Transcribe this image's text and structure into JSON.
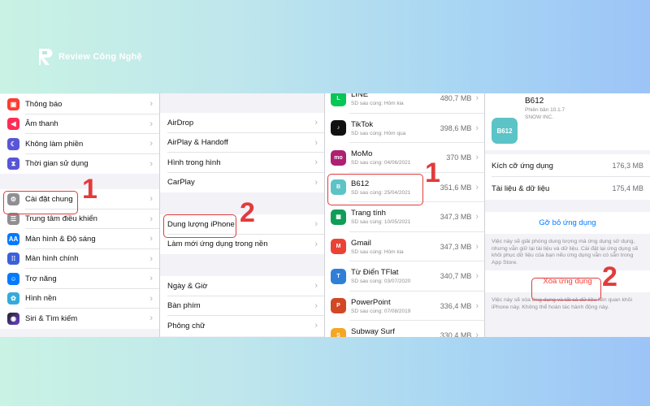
{
  "brand": {
    "name": "Review Công Nghệ"
  },
  "settings_panel": {
    "groups": [
      [
        {
          "label": "Thông báo",
          "icon": "notification-icon",
          "color": "#ff3b30"
        },
        {
          "label": "Âm thanh",
          "icon": "sound-icon",
          "color": "#ff2d55"
        },
        {
          "label": "Không làm phiền",
          "icon": "moon-icon",
          "color": "#5856d6"
        },
        {
          "label": "Thời gian sử dụng",
          "icon": "hourglass-icon",
          "color": "#5856d6"
        }
      ],
      [
        {
          "label": "Cài đặt chung",
          "icon": "gear-icon",
          "color": "#8e8e93"
        },
        {
          "label": "Trung tâm điều khiển",
          "icon": "control-center-icon",
          "color": "#8e8e93"
        },
        {
          "label": "Màn hình & Độ sáng",
          "icon": "display-icon",
          "color": "#007aff"
        },
        {
          "label": "Màn hình chính",
          "icon": "home-screen-icon",
          "color": "#3c5fdc"
        },
        {
          "label": "Trợ năng",
          "icon": "accessibility-icon",
          "color": "#007aff"
        },
        {
          "label": "Hình nền",
          "icon": "wallpaper-icon",
          "color": "#34aadc"
        },
        {
          "label": "Siri & Tìm kiếm",
          "icon": "siri-icon",
          "color": "#222222"
        }
      ]
    ],
    "step": "1"
  },
  "general_panel": {
    "groups": [
      [
        "AirDrop",
        "AirPlay & Handoff",
        "Hình trong hình",
        "CarPlay"
      ],
      [
        "Dung lượng iPhone",
        "Làm mới ứng dụng trong nền"
      ],
      [
        "Ngày & Giờ",
        "Bàn phím",
        "Phông chữ"
      ]
    ],
    "step": "2"
  },
  "storage_panel": {
    "apps": [
      {
        "name": "LINE",
        "meta": "SD sau cùng: Hôm kia",
        "size": "480,7 MB",
        "color": "#06c755",
        "icon": "line-app-icon",
        "glyph": "L"
      },
      {
        "name": "TikTok",
        "meta": "SD sau cùng: Hôm qua",
        "size": "398,6 MB",
        "color": "#111111",
        "icon": "tiktok-app-icon",
        "glyph": "♪"
      },
      {
        "name": "MoMo",
        "meta": "SD sau cùng: 04/06/2021",
        "size": "370 MB",
        "color": "#ae2070",
        "icon": "momo-app-icon",
        "glyph": "mo"
      },
      {
        "name": "B612",
        "meta": "SD sau cùng: 25/04/2021",
        "size": "351,6 MB",
        "color": "#5cc3c7",
        "icon": "b612-app-icon",
        "glyph": "B"
      },
      {
        "name": "Trang tính",
        "meta": "SD sau cùng: 10/05/2021",
        "size": "347,3 MB",
        "color": "#0f9d58",
        "icon": "sheets-app-icon",
        "glyph": "▦"
      },
      {
        "name": "Gmail",
        "meta": "SD sau cùng: Hôm kia",
        "size": "347,3 MB",
        "color": "#ea4335",
        "icon": "gmail-app-icon",
        "glyph": "M"
      },
      {
        "name": "Từ Điển TFlat",
        "meta": "SD sau cùng: 03/07/2020",
        "size": "340,7 MB",
        "color": "#2f7fd8",
        "icon": "tflat-app-icon",
        "glyph": "T"
      },
      {
        "name": "PowerPoint",
        "meta": "SD sau cùng: 07/08/2019",
        "size": "336,4 MB",
        "color": "#d24726",
        "icon": "powerpoint-app-icon",
        "glyph": "P"
      },
      {
        "name": "Subway Surf",
        "meta": "SD sau cùng: 17/05/2021",
        "size": "330,4 MB",
        "color": "#f5a623",
        "icon": "subway-app-icon",
        "glyph": "S"
      }
    ],
    "step": "1"
  },
  "detail_panel": {
    "app_name": "B612",
    "version": "Phiên bản 10.1.7",
    "developer": "SNOW INC.",
    "icon_text": "B612",
    "app_size_label": "Kích cỡ ứng dụng",
    "app_size_value": "176,3 MB",
    "data_label": "Tài liệu & dữ liệu",
    "data_value": "175,4 MB",
    "offload_label": "Gỡ bỏ ứng dụng",
    "offload_note": "Việc này sẽ giải phóng dung lượng mà ứng dụng sử dụng, nhưng vẫn giữ lại tài liệu và dữ liệu. Cài đặt lại ứng dụng sẽ khôi phục dữ liệu của bạn nếu ứng dụng vẫn có sẵn trong App Store.",
    "delete_label": "Xóa ứng dụng",
    "delete_note": "Việc này sẽ xóa ứng dụng và tất cả dữ liệu liên quan khỏi iPhone này. Không thể hoàn tác hành động này.",
    "step": "2",
    "link_color": "#007aff",
    "delete_color": "#ff3b30"
  }
}
